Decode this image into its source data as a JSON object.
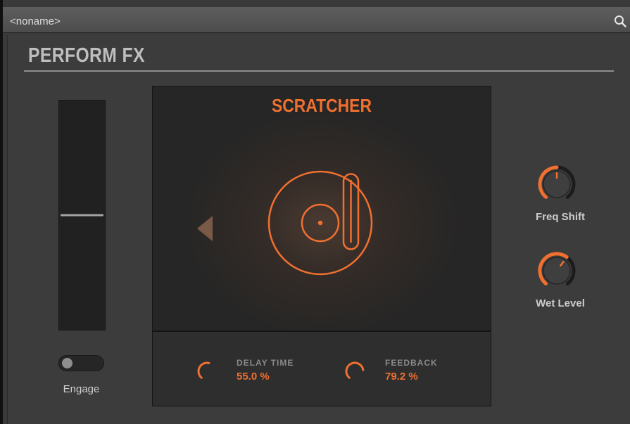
{
  "window": {
    "title": "<noname>"
  },
  "page": {
    "title": "PERFORM FX"
  },
  "fader": {
    "level": 0.5
  },
  "engage": {
    "label": "Engage",
    "state": "off"
  },
  "effect": {
    "name": "SCRATCHER",
    "icon": "turntable-icon",
    "params": [
      {
        "label": "DELAY TIME",
        "value": "55.0 %",
        "amount": 0.55
      },
      {
        "label": "FEEDBACK",
        "value": "79.2 %",
        "amount": 0.792
      }
    ]
  },
  "knobs": [
    {
      "label": "Freq Shift",
      "amount": 0.5
    },
    {
      "label": "Wet Level",
      "amount": 0.63
    }
  ],
  "colors": {
    "accent": "#f07030",
    "knob_track": "#1c1c1c",
    "knob_body": "#3f3f3f"
  }
}
